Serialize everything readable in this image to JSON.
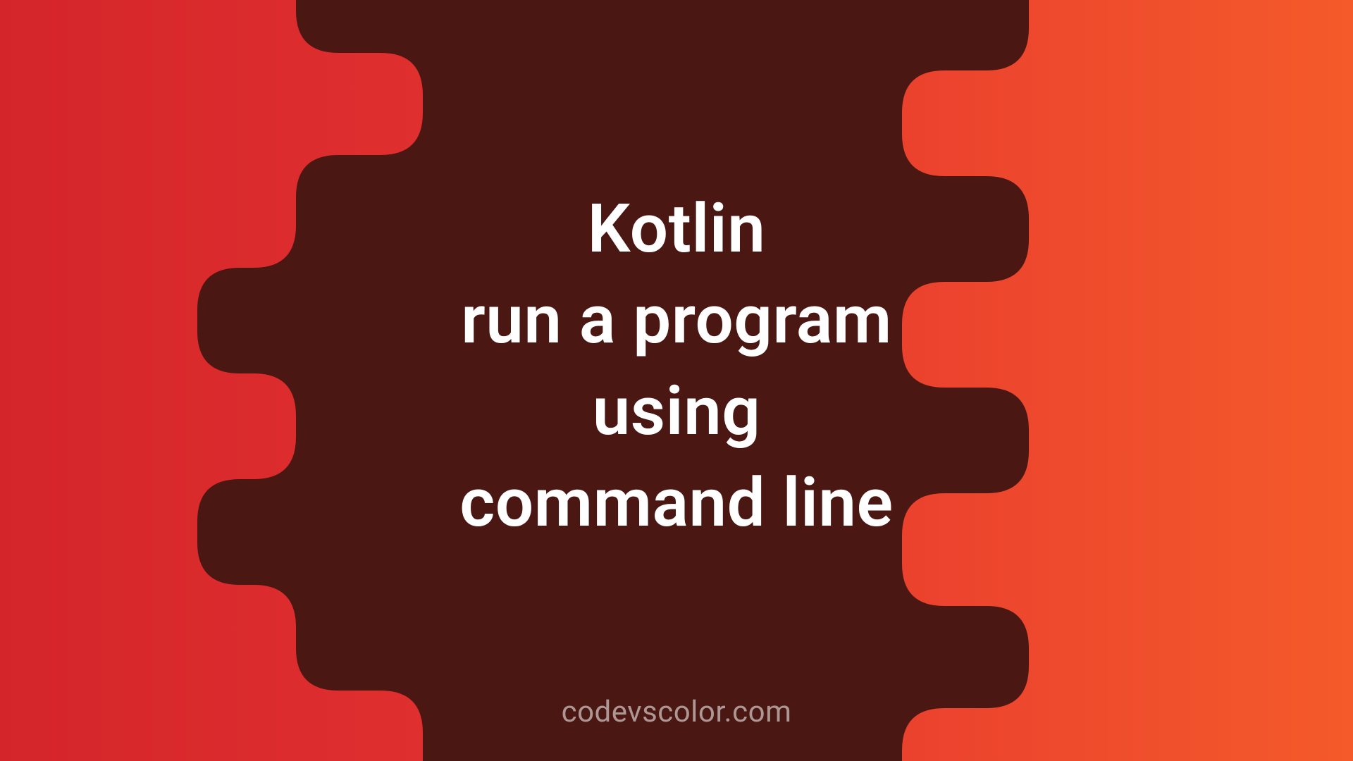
{
  "title": {
    "line1": "Kotlin",
    "line2": "run a program",
    "line3": "using",
    "line4": "command line"
  },
  "watermark": "codevscolor.com",
  "colors": {
    "blob": "#4a1712",
    "gradient_left": "#d4252b",
    "gradient_right": "#f45a2a",
    "text": "#ffffff"
  }
}
